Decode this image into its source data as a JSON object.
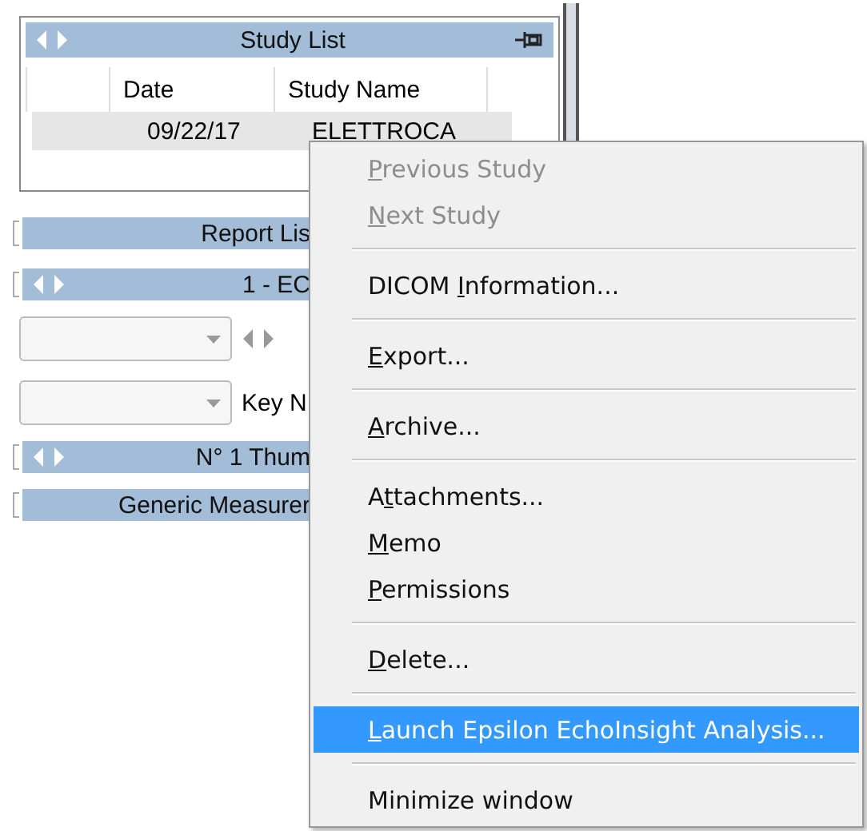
{
  "study_list": {
    "title": "Study List",
    "columns": [
      "Date",
      "Study Name"
    ],
    "rows": [
      {
        "date": "09/22/17",
        "study_name": "ELETTROCA",
        "selected": true
      }
    ]
  },
  "report_list": {
    "title": "Report Lis"
  },
  "echo_panel": {
    "title": "1 - EC"
  },
  "key_combo": {
    "label": "Key N"
  },
  "thumbnail_panel": {
    "title": "N° 1 Thum"
  },
  "measure_panel": {
    "title": "Generic Measurer"
  },
  "context_menu": [
    {
      "kind": "item",
      "key": "P",
      "post": "revious Study",
      "disabled": true,
      "selected": false
    },
    {
      "kind": "item",
      "key": "N",
      "post": "ext Study",
      "disabled": true,
      "selected": false
    },
    {
      "kind": "separator"
    },
    {
      "kind": "item",
      "pre": "DICOM ",
      "key": "I",
      "post": "nformation...",
      "disabled": false,
      "selected": false
    },
    {
      "kind": "separator"
    },
    {
      "kind": "item",
      "key": "E",
      "post": "xport...",
      "disabled": false,
      "selected": false
    },
    {
      "kind": "separator"
    },
    {
      "kind": "item",
      "key": "A",
      "post": "rchive...",
      "disabled": false,
      "selected": false
    },
    {
      "kind": "separator"
    },
    {
      "kind": "item",
      "pre": "A",
      "key": "t",
      "post": "tachments...",
      "disabled": false,
      "selected": false
    },
    {
      "kind": "item",
      "key": "M",
      "post": "emo",
      "disabled": false,
      "selected": false
    },
    {
      "kind": "item",
      "key": "P",
      "post": "ermissions",
      "disabled": false,
      "selected": false
    },
    {
      "kind": "separator"
    },
    {
      "kind": "item",
      "key": "D",
      "post": "elete...",
      "disabled": false,
      "selected": false
    },
    {
      "kind": "separator"
    },
    {
      "kind": "item",
      "key": "L",
      "post": "aunch Epsilon EchoInsight Analysis...",
      "disabled": false,
      "selected": true
    },
    {
      "kind": "separator"
    },
    {
      "kind": "item",
      "pre": "Minimize window",
      "disabled": false,
      "selected": false
    }
  ]
}
